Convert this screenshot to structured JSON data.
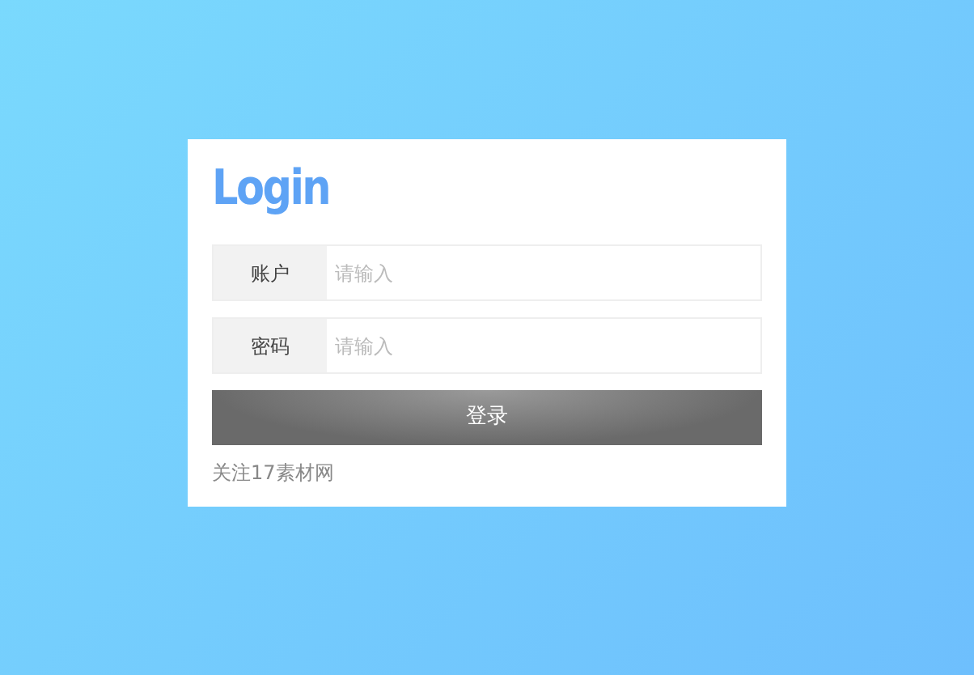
{
  "title": "Login",
  "fields": [
    {
      "label": "账户",
      "placeholder": "请输入"
    },
    {
      "label": "密码",
      "placeholder": "请输入"
    }
  ],
  "button": "登录",
  "footer": "关注17素材网"
}
